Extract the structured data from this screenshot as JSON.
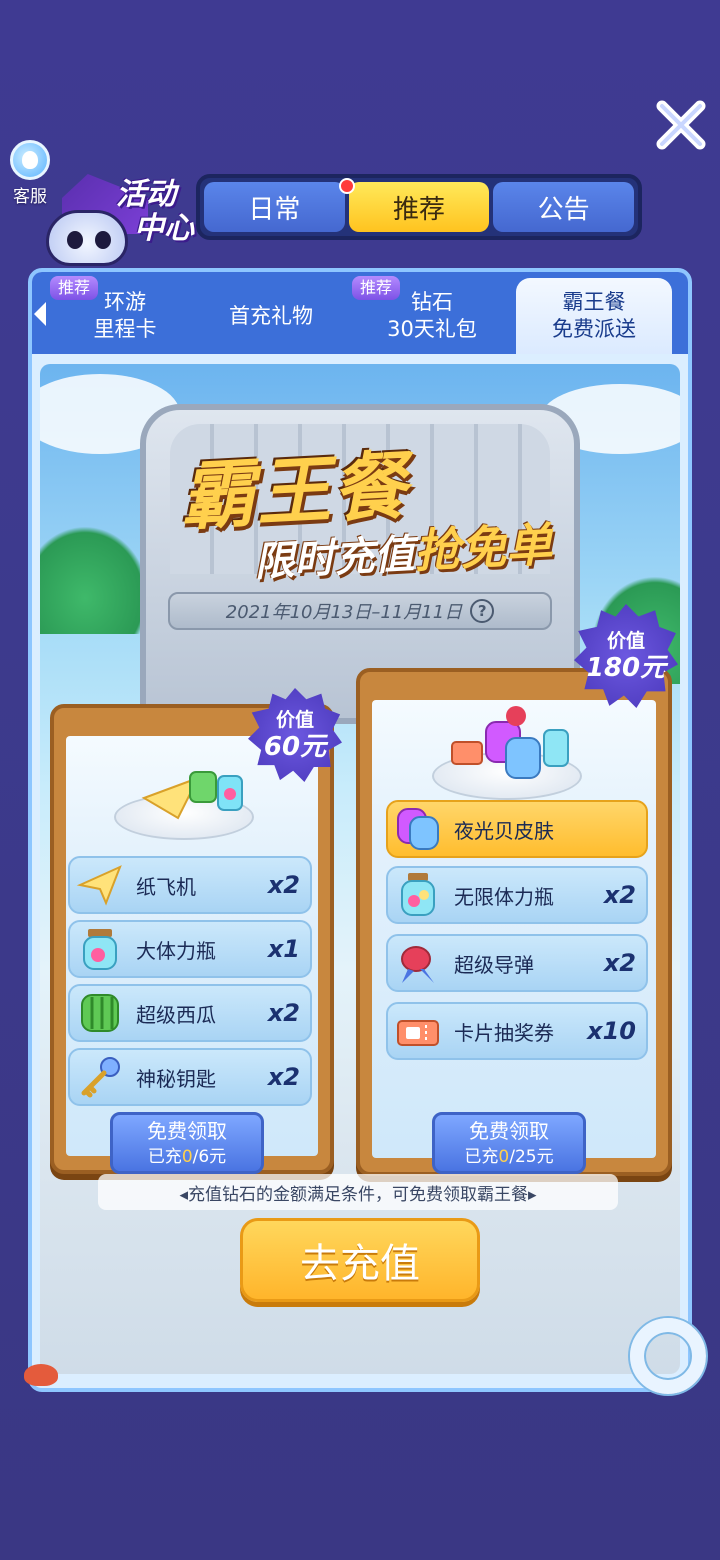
{
  "header": {
    "customer_service_label": "客服",
    "logo_title_line1": "活动",
    "logo_title_line2": "中心"
  },
  "top_tabs": [
    {
      "label": "日常",
      "active": false
    },
    {
      "label": "推荐",
      "active": true
    },
    {
      "label": "公告",
      "active": false
    }
  ],
  "sub_tabs": [
    {
      "line1": "环游",
      "line2": "里程卡",
      "badge": "推荐"
    },
    {
      "line1": "首充礼物",
      "line2": "",
      "badge": ""
    },
    {
      "line1": "钻石",
      "line2": "30天礼包",
      "badge": "推荐"
    },
    {
      "line1": "霸王餐",
      "line2": "免费派送",
      "badge": "",
      "active": true
    }
  ],
  "banner": {
    "title": "霸王餐",
    "subtitle_part1": "限时充值",
    "subtitle_part2": "抢免单",
    "date_range": "2021年10月13日–11月11日",
    "help_symbol": "?"
  },
  "boards": [
    {
      "value_label": "价值",
      "value": "60元",
      "items": [
        {
          "name": "纸飞机",
          "qty": "x2",
          "icon": "paper-plane-icon"
        },
        {
          "name": "大体力瓶",
          "qty": "x1",
          "icon": "stamina-bottle-icon"
        },
        {
          "name": "超级西瓜",
          "qty": "x2",
          "icon": "watermelon-icon"
        },
        {
          "name": "神秘钥匙",
          "qty": "x2",
          "icon": "key-icon"
        }
      ],
      "claim_label": "免费领取",
      "progress_prefix": "已充",
      "progress_current": "0",
      "progress_suffix": "/6元"
    },
    {
      "value_label": "价值",
      "value": "180元",
      "items": [
        {
          "name": "夜光贝皮肤",
          "qty": "",
          "icon": "shell-skin-icon",
          "highlight": true
        },
        {
          "name": "无限体力瓶",
          "qty": "x2",
          "icon": "infinite-stamina-icon"
        },
        {
          "name": "超级导弹",
          "qty": "x2",
          "icon": "missile-icon"
        },
        {
          "name": "卡片抽奖券",
          "qty": "x10",
          "icon": "ticket-icon"
        }
      ],
      "claim_label": "免费领取",
      "progress_prefix": "已充",
      "progress_current": "0",
      "progress_suffix": "/25元"
    }
  ],
  "note": "◂充值钻石的金额满足条件，可免费领取霸王餐▸",
  "recharge_button": "去充值",
  "colors": {
    "background": "#3f3a92",
    "tab_active": "#ffc31f",
    "tab_inactive": "#4568d0",
    "recharge_button": "#ffb52b",
    "claim_button": "#4a74e2"
  }
}
